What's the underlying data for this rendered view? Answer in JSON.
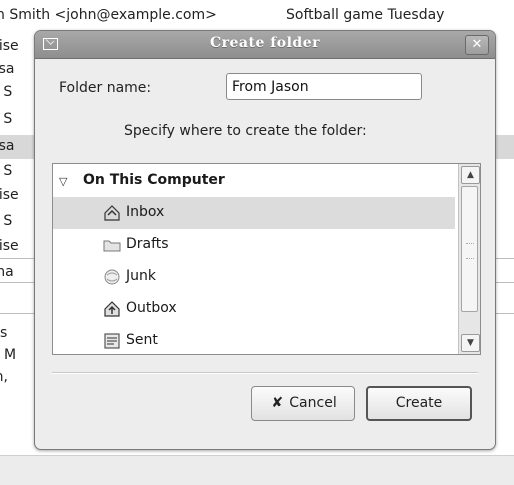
{
  "background": {
    "header_sender": "n Smith <john@example.com>",
    "header_subject": "Softball game Tuesday",
    "rows": [
      "nise",
      "esa",
      "n S",
      "n S",
      "esa",
      "n S",
      "nise",
      "n S",
      "nise"
    ],
    "pane_header": "rma",
    "pane_lines": [
      "res",
      "E: M",
      "on,"
    ]
  },
  "dialog": {
    "title": "Create folder",
    "close_glyph": "✕",
    "folder_name_label": "Folder name:",
    "folder_name_value": "From Jason",
    "specify_text": "Specify where to create the folder:",
    "tree": {
      "root_expander": "▽",
      "root_label": "On This Computer",
      "items": [
        {
          "label": "Inbox",
          "icon": "inbox-icon",
          "selected": true
        },
        {
          "label": "Drafts",
          "icon": "drafts-icon",
          "selected": false
        },
        {
          "label": "Junk",
          "icon": "junk-icon",
          "selected": false
        },
        {
          "label": "Outbox",
          "icon": "outbox-icon",
          "selected": false
        },
        {
          "label": "Sent",
          "icon": "sent-icon",
          "selected": false
        }
      ]
    },
    "scroll_up": "▲",
    "scroll_down": "▼",
    "buttons": {
      "cancel": "Cancel",
      "create": "Create"
    }
  }
}
